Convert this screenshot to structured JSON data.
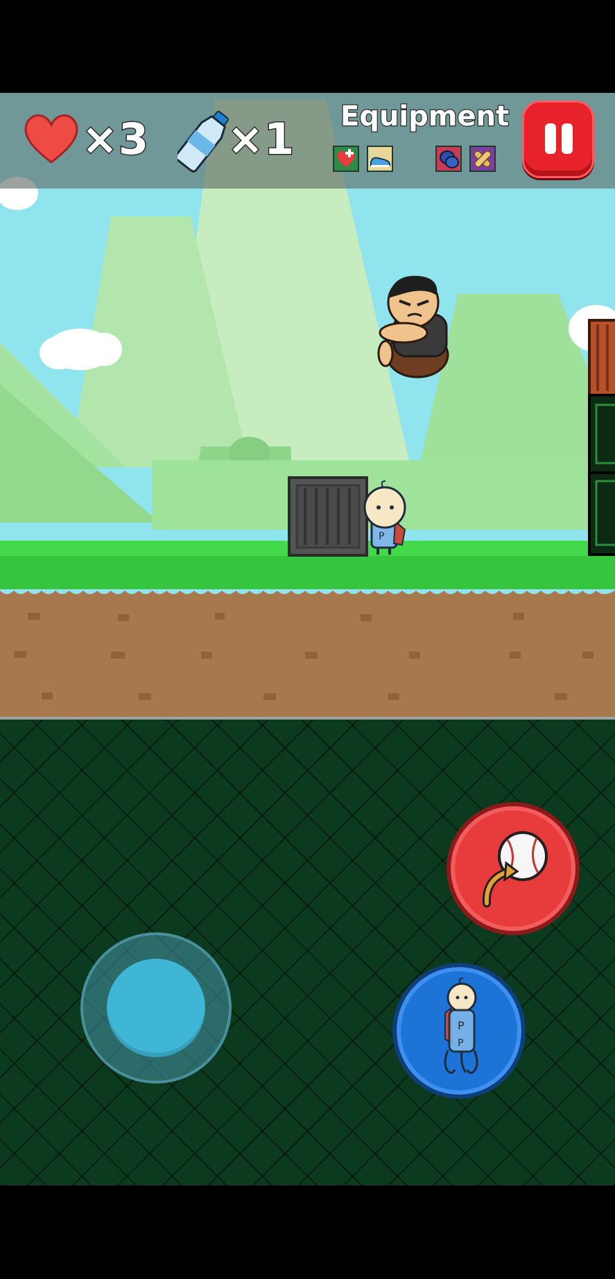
{
  "hud": {
    "lives_icon": "heart-icon",
    "lives_count": "×3",
    "bottles_icon": "water-bottle-icon",
    "bottles_count": "×1",
    "equipment_title": "Equipment",
    "equipment_slots": [
      {
        "icon": "heart-plus-icon",
        "color": "#2f8a4a"
      },
      {
        "icon": "shoe-icon",
        "color": "#e8d79a"
      },
      {
        "icon": "boxing-glove-icon",
        "color": "#c63b55"
      },
      {
        "icon": "bandage-icon",
        "color": "#7a3fa0"
      }
    ],
    "pause_icon": "pause-icon"
  },
  "controls": {
    "joystick": "virtual-joystick",
    "throw_icon": "baseball-throw-icon",
    "special_icon": "hero-special-icon"
  },
  "colors": {
    "pause_button": "#e8222a",
    "throw_button": "#e83b3b",
    "special_button": "#1e74d6",
    "joystick": "#3fb6d6",
    "grass": "#43d94a",
    "dirt": "#a6784c"
  }
}
